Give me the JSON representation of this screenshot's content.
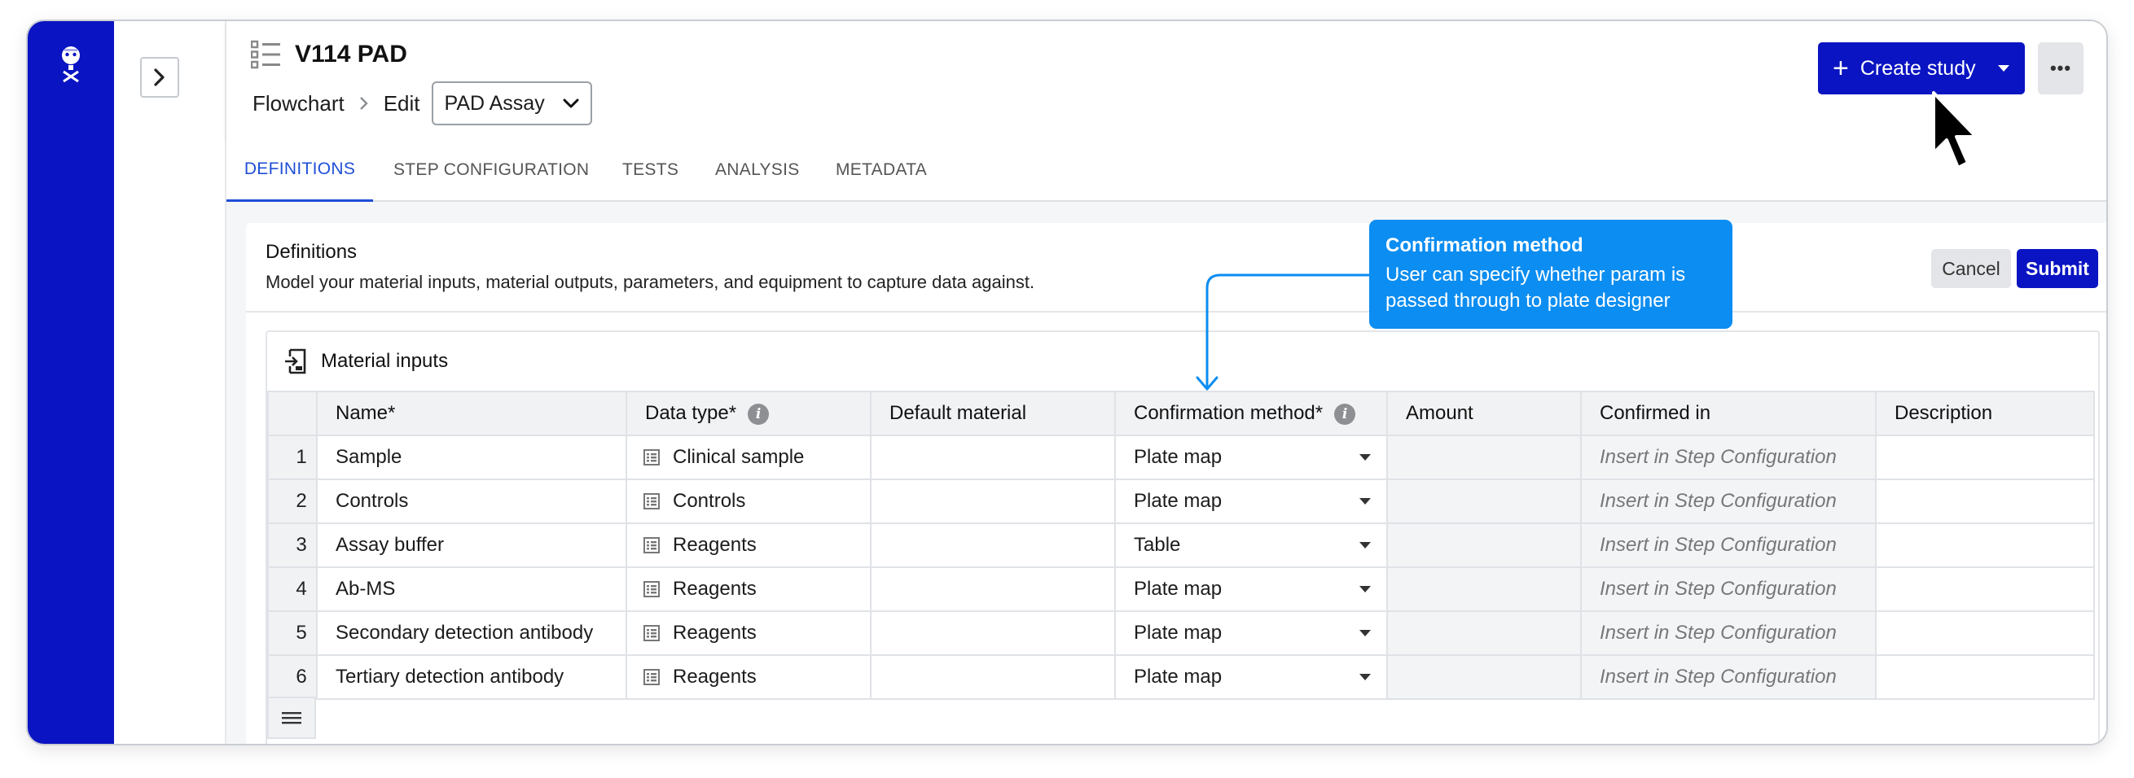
{
  "header": {
    "title": "V114 PAD",
    "breadcrumb": {
      "flowchart": "Flowchart",
      "edit": "Edit"
    },
    "assay_select": "PAD Assay",
    "create_label": "Create study",
    "more_label": "•••"
  },
  "tabs": [
    {
      "label": "DEFINITIONS",
      "active": true
    },
    {
      "label": "STEP CONFIGURATION",
      "active": false
    },
    {
      "label": "TESTS",
      "active": false
    },
    {
      "label": "ANALYSIS",
      "active": false
    },
    {
      "label": "METADATA",
      "active": false
    }
  ],
  "definitions": {
    "title": "Definitions",
    "description": "Model your material inputs, material outputs, parameters, and equipment to capture data against.",
    "cancel": "Cancel",
    "submit": "Submit"
  },
  "tooltip": {
    "title": "Confirmation method",
    "body_line1": "User can specify whether param is",
    "body_line2": "passed through to plate designer"
  },
  "material_inputs": {
    "title": "Material inputs",
    "columns": [
      "Name*",
      "Data type*",
      "Default material",
      "Confirmation method*",
      "Amount",
      "Confirmed in",
      "Description"
    ],
    "rows": [
      {
        "num": "1",
        "name": "Sample",
        "dtype": "Clinical sample",
        "default": "",
        "confirm": "Plate map",
        "amount": "",
        "confirmed_in": "Insert in Step Configuration",
        "description": ""
      },
      {
        "num": "2",
        "name": "Controls",
        "dtype": "Controls",
        "default": "",
        "confirm": "Plate map",
        "amount": "",
        "confirmed_in": "Insert in Step Configuration",
        "description": ""
      },
      {
        "num": "3",
        "name": "Assay buffer",
        "dtype": "Reagents",
        "default": "",
        "confirm": "Table",
        "amount": "",
        "confirmed_in": "Insert in Step Configuration",
        "description": ""
      },
      {
        "num": "4",
        "name": "Ab-MS",
        "dtype": "Reagents",
        "default": "",
        "confirm": "Plate map",
        "amount": "",
        "confirmed_in": "Insert in Step Configuration",
        "description": ""
      },
      {
        "num": "5",
        "name": "Secondary detection antibody",
        "dtype": "Reagents",
        "default": "",
        "confirm": "Plate map",
        "amount": "",
        "confirmed_in": "Insert in Step Configuration",
        "description": ""
      },
      {
        "num": "6",
        "name": "Tertiary detection antibody",
        "dtype": "Reagents",
        "default": "",
        "confirm": "Plate map",
        "amount": "",
        "confirmed_in": "Insert in Step Configuration",
        "description": ""
      }
    ]
  },
  "colors": {
    "brand": "#0a14c2",
    "tooltip": "#0c8df1",
    "active_tab": "#1f4fd6"
  }
}
